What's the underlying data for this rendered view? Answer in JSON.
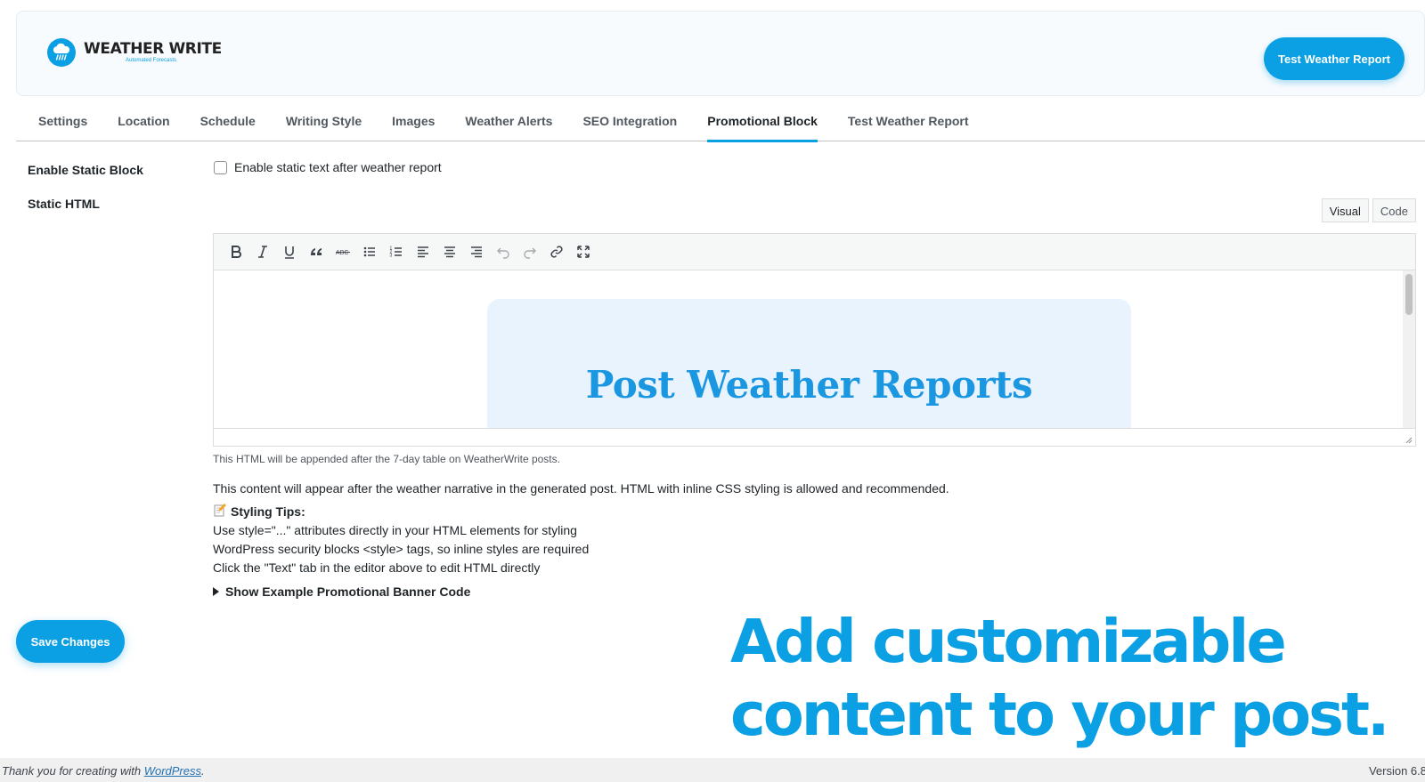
{
  "header": {
    "logo_title": "WEATHER WRITE",
    "logo_subtitle": "Automated Forecasts",
    "test_button_label": "Test Weather Report"
  },
  "tabs": [
    {
      "label": "Settings"
    },
    {
      "label": "Location"
    },
    {
      "label": "Schedule"
    },
    {
      "label": "Writing Style"
    },
    {
      "label": "Images"
    },
    {
      "label": "Weather Alerts"
    },
    {
      "label": "SEO Integration"
    },
    {
      "label": "Promotional Block",
      "active": true
    },
    {
      "label": "Test Weather Report"
    }
  ],
  "form": {
    "enable_label": "Enable Static Block",
    "enable_checkbox_text": "Enable static text after weather report",
    "enable_checked": false,
    "static_html_label": "Static HTML"
  },
  "editor": {
    "mode_visual": "Visual",
    "mode_code": "Code",
    "toolbar_icons": [
      "bold-icon",
      "italic-icon",
      "underline-icon",
      "blockquote-icon",
      "strikethrough-icon",
      "bullet-list-icon",
      "numbered-list-icon",
      "align-left-icon",
      "align-center-icon",
      "align-right-icon",
      "undo-icon",
      "redo-icon",
      "link-icon",
      "fullscreen-icon"
    ],
    "content_title": "Post Weather Reports",
    "hint": "This HTML will be appended after the 7-day table on WeatherWrite posts."
  },
  "help": {
    "description": "This content will appear after the weather narrative in the generated post. HTML with inline CSS styling is allowed and recommended.",
    "tips_heading": "Styling Tips:",
    "tips_icon": "memo-icon",
    "tips": [
      "Use style=\"...\" attributes directly in your HTML elements for styling",
      "WordPress security blocks <style> tags, so inline styles are required",
      "Click the \"Text\" tab in the editor above to edit HTML directly"
    ],
    "example_toggle": "Show Example Promotional Banner Code"
  },
  "save_button_label": "Save Changes",
  "overlay": {
    "line1": "Add customizable",
    "line2": "content to your post."
  },
  "footer": {
    "thanks_prefix": "Thank you for creating with ",
    "link_text": "WordPress",
    "thanks_suffix": ".",
    "version": "Version 6.8"
  },
  "colors": {
    "accent": "#0b9fe3",
    "promo_bg": "#e8f3fd",
    "promo_title": "#1a97e0"
  }
}
